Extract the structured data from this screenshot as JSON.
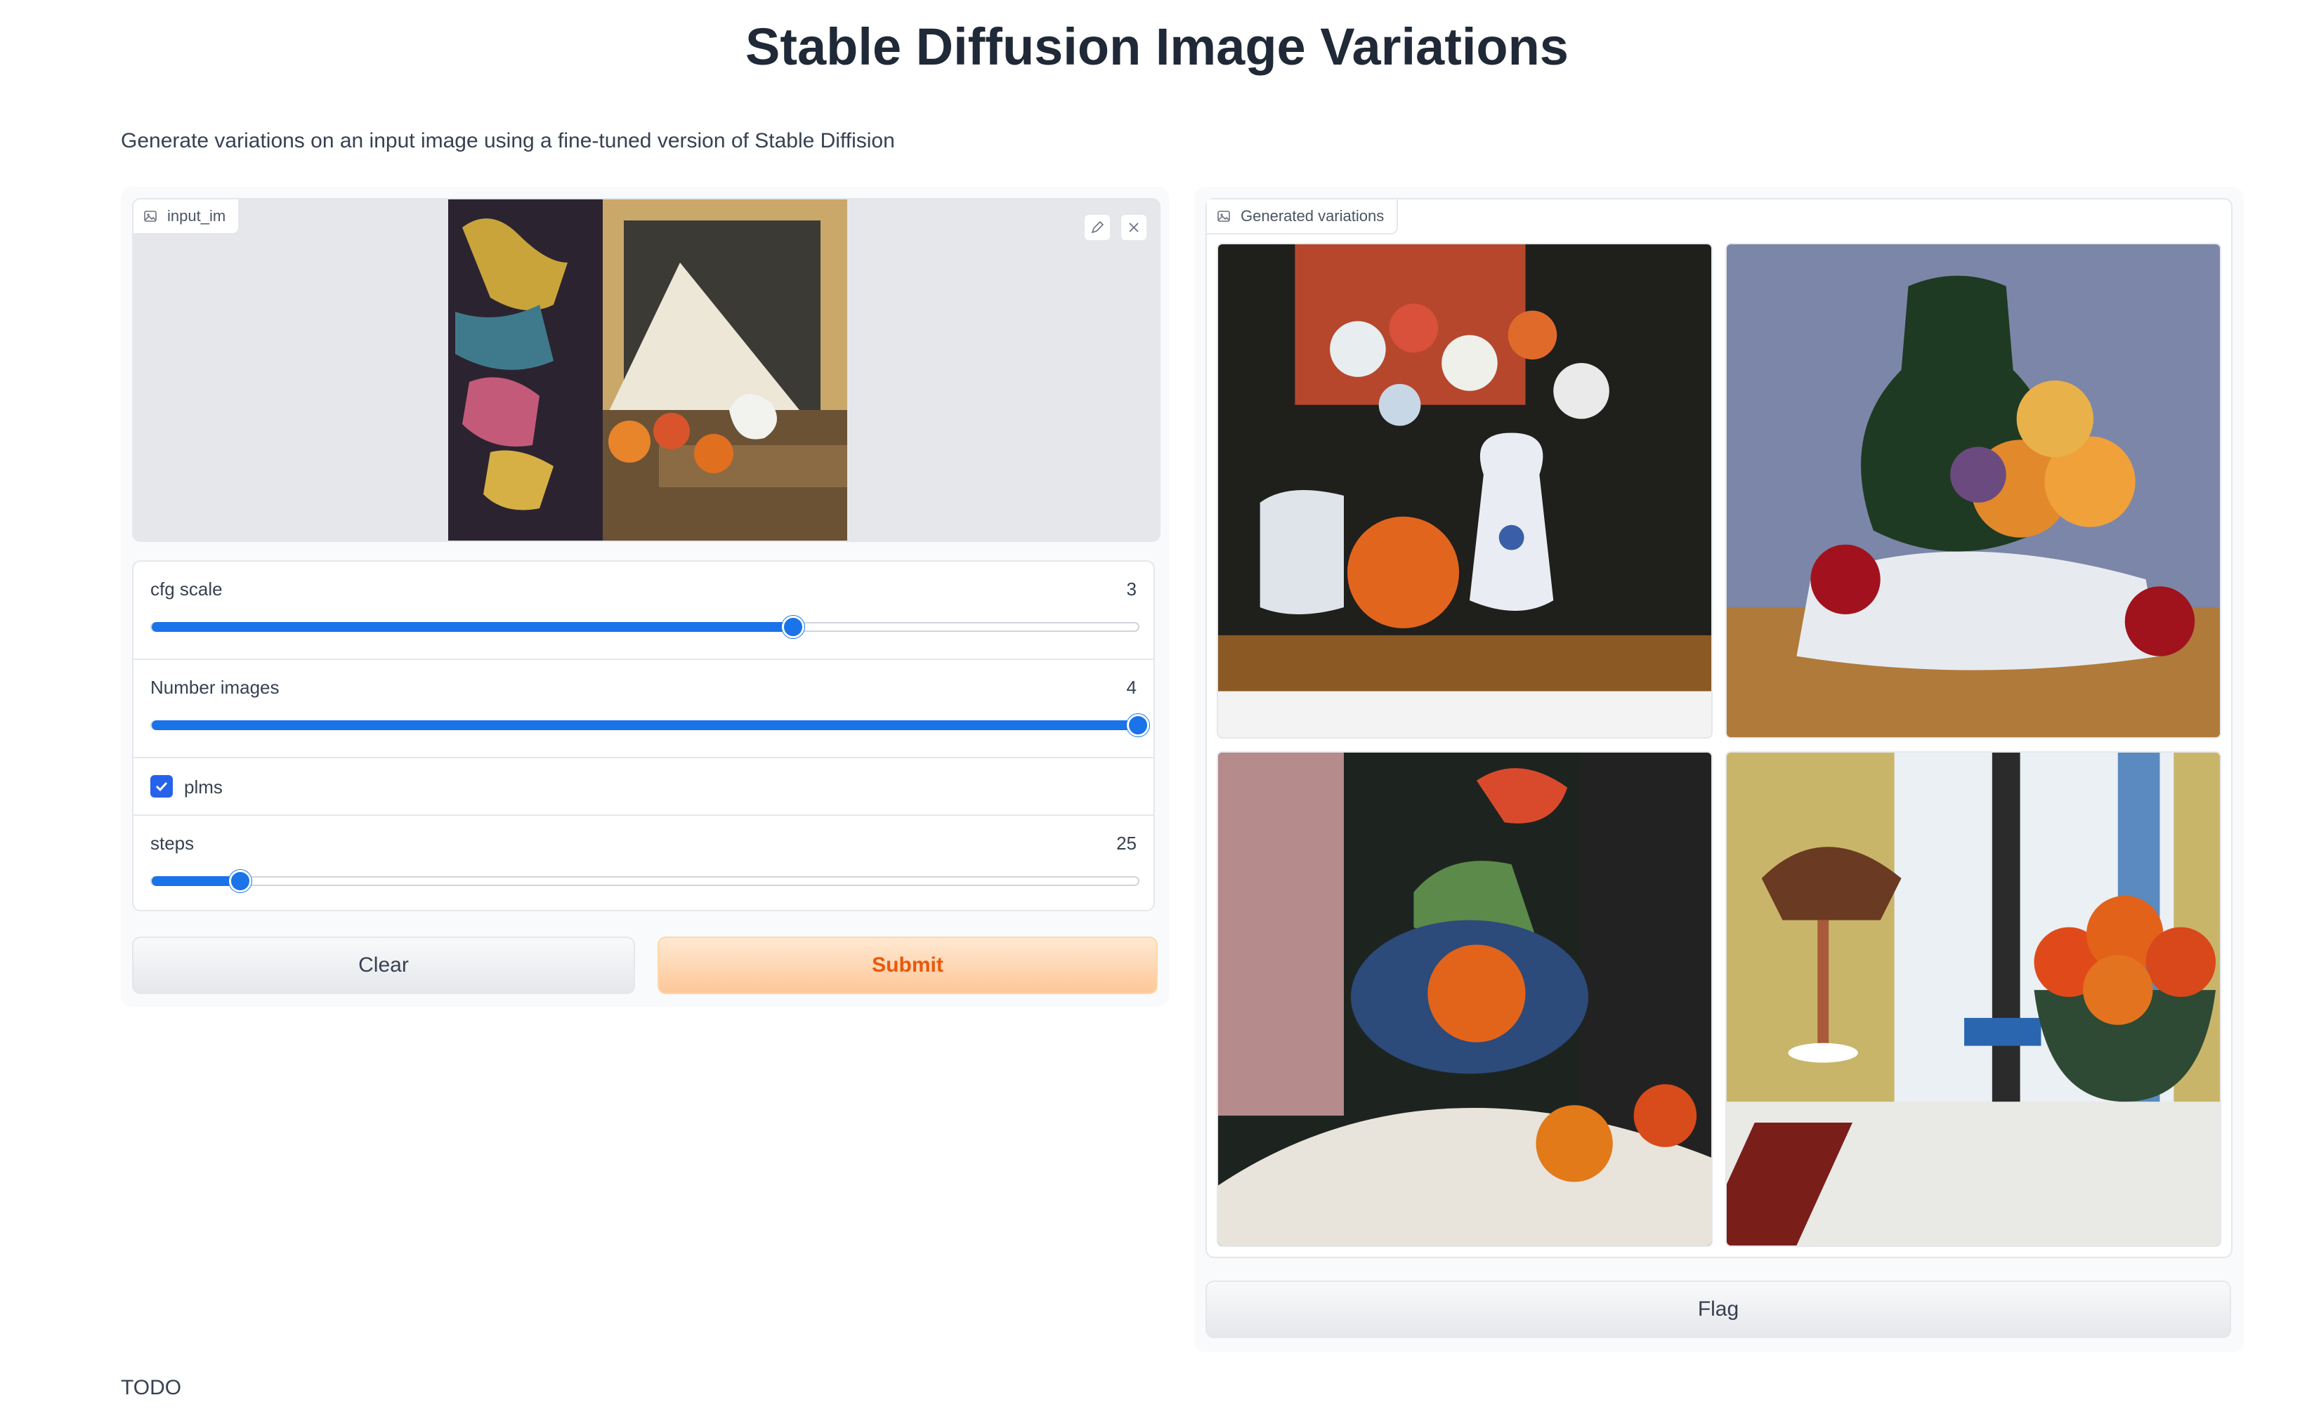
{
  "page": {
    "title": "Stable Diffusion Image Variations",
    "description": "Generate variations on an input image using a fine-tuned version of Stable Diffision",
    "footer": "TODO"
  },
  "input_panel": {
    "image_label": "input_im",
    "controls": {
      "cfg_scale": {
        "label": "cfg scale",
        "value": "3",
        "fraction": 0.65
      },
      "number_images": {
        "label": "Number images",
        "value": "4",
        "fraction": 1.0
      },
      "plms": {
        "label": "plms",
        "checked": true
      },
      "steps": {
        "label": "steps",
        "value": "25",
        "fraction": 0.09
      }
    },
    "clear_label": "Clear",
    "submit_label": "Submit"
  },
  "output_panel": {
    "gallery_label": "Generated variations",
    "images": [
      {
        "name": "variation-1",
        "description_icon": "still-life-flowers"
      },
      {
        "name": "variation-2",
        "description_icon": "still-life-vase-fruit"
      },
      {
        "name": "variation-3",
        "description_icon": "still-life-bowl-orange"
      },
      {
        "name": "variation-4",
        "description_icon": "still-life-lamp-fruit"
      }
    ],
    "flag_label": "Flag"
  },
  "colors": {
    "accent": "#1a73e8",
    "submit_text": "#ea580c",
    "submit_bg": "#fdc797"
  }
}
